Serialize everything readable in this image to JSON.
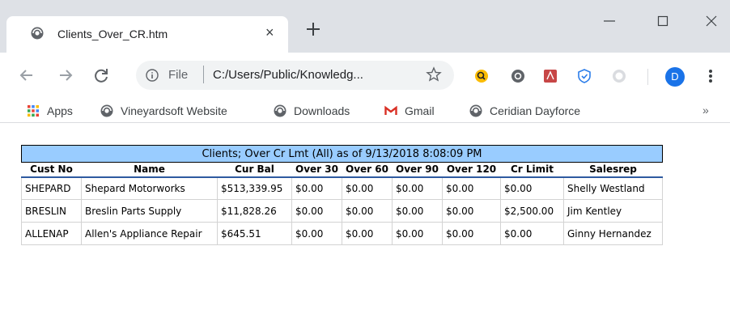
{
  "browser": {
    "tab_title": "Clients_Over_CR.htm",
    "tab_close": "×",
    "new_tab": "+",
    "omnibox": {
      "scheme": "File",
      "url": "C:/Users/Public/Knowledg..."
    },
    "profile_initial": "D",
    "bookmarks": [
      {
        "label": "Apps",
        "icon": "apps-grid-icon"
      },
      {
        "label": "Vineyardsoft Website",
        "icon": "globe-icon"
      },
      {
        "label": "Downloads",
        "icon": "globe-icon"
      },
      {
        "label": "Gmail",
        "icon": "gmail-icon"
      },
      {
        "label": "Ceridian Dayforce",
        "icon": "globe-icon"
      }
    ],
    "bookmarks_more": "»"
  },
  "report": {
    "title": "Clients; Over Cr Lmt (All) as of 9/13/2018 8:08:09 PM",
    "columns": [
      "Cust No",
      "Name",
      "Cur Bal",
      "Over 30",
      "Over 60",
      "Over 90",
      "Over 120",
      "Cr Limit",
      "Salesrep"
    ],
    "rows": [
      [
        "SHEPARD",
        "Shepard Motorworks",
        "$513,339.95",
        "$0.00",
        "$0.00",
        "$0.00",
        "$0.00",
        "$0.00",
        "Shelly Westland"
      ],
      [
        "BRESLIN",
        "Breslin Parts Supply",
        "$11,828.26",
        "$0.00",
        "$0.00",
        "$0.00",
        "$0.00",
        "$2,500.00",
        "Jim Kentley"
      ],
      [
        "ALLENAP",
        "Allen's Appliance Repair",
        "$645.51",
        "$0.00",
        "$0.00",
        "$0.00",
        "$0.00",
        "$0.00",
        "Ginny Hernandez"
      ]
    ]
  },
  "colors": {
    "title_bg": "#99ccff",
    "header_rule": "#2e5aa0",
    "tabstrip_bg": "#dee1e6"
  }
}
